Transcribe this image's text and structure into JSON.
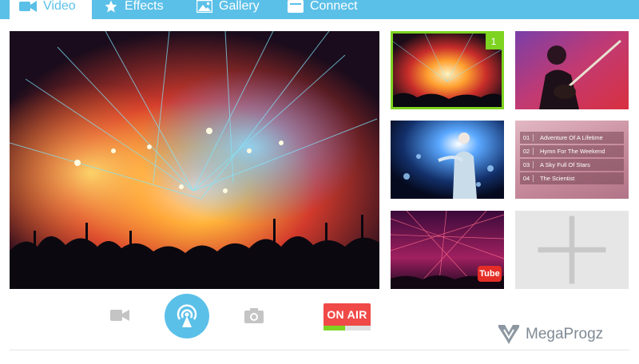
{
  "tabs": [
    {
      "label": "Video",
      "icon": "video-camera-icon",
      "active": true
    },
    {
      "label": "Effects",
      "icon": "star-icon",
      "active": false
    },
    {
      "label": "Gallery",
      "icon": "image-icon",
      "active": false
    },
    {
      "label": "Connect",
      "icon": "connect-icon",
      "active": false
    }
  ],
  "thumbnails": {
    "selected_badge": "1",
    "playlist": [
      {
        "num": "01",
        "title": "Adventure Of A Lifetime"
      },
      {
        "num": "02",
        "title": "Hymn For The Weekend"
      },
      {
        "num": "03",
        "title": "A Sky Full Of Stars"
      },
      {
        "num": "04",
        "title": "The Scientist"
      }
    ],
    "youtube_label": "Tube",
    "add_icon": "plus-icon"
  },
  "controls": {
    "on_air_label": "ON AIR",
    "on_air_level": 0.45,
    "video_icon": "video-camera-icon",
    "broadcast_icon": "broadcast-icon",
    "camera_icon": "camera-icon"
  },
  "watermark": "MegaProgz",
  "colors": {
    "accent": "#5bc0e8",
    "selected": "#7ed321",
    "on_air": "#f04a48"
  }
}
